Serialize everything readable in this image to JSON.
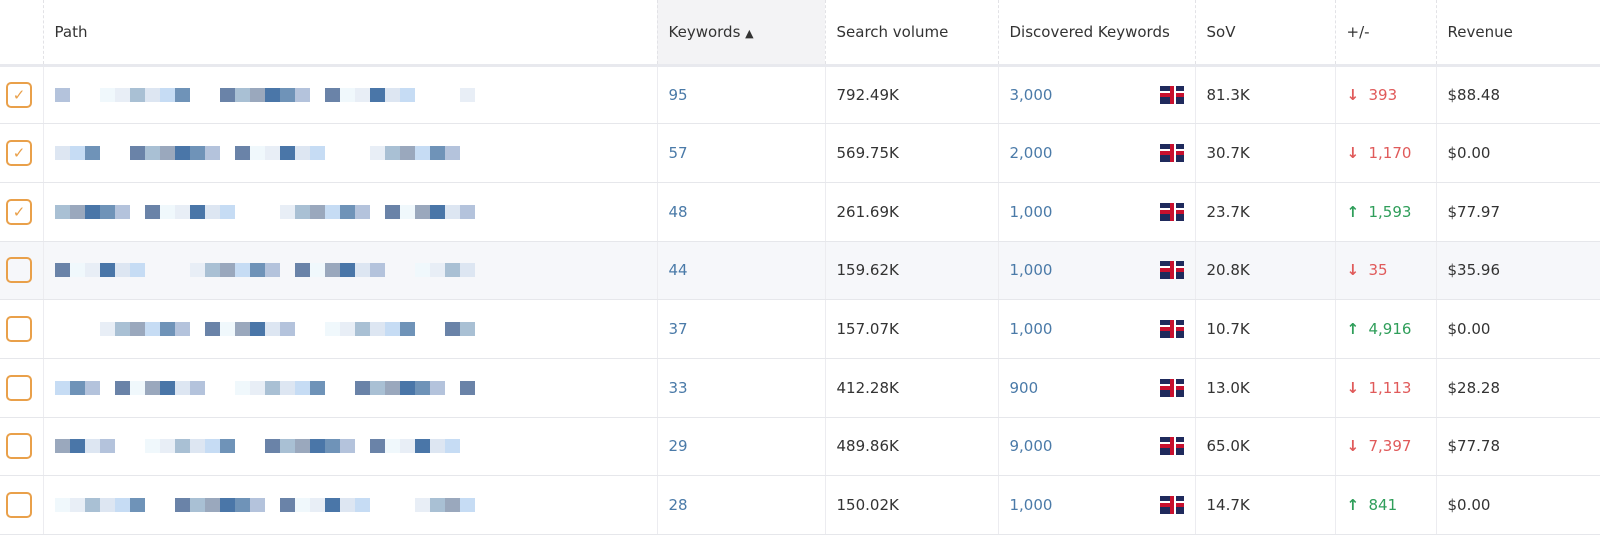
{
  "columns": {
    "path": "Path",
    "keywords": "Keywords",
    "keywords_sort": "▲",
    "search_volume": "Search volume",
    "discovered": "Discovered Keywords",
    "sov": "SoV",
    "change": "+/-",
    "revenue": "Revenue"
  },
  "colors": {
    "checkbox": "#e9a04a",
    "link": "#4a7aa8",
    "down": "#e05a5a",
    "up": "#2f9e5a"
  },
  "rows": [
    {
      "checked": true,
      "keywords": "95",
      "search_volume": "792.49K",
      "discovered": "3,000",
      "country": "uk-flag-icon",
      "sov": "81.3K",
      "dir": "down",
      "change": "393",
      "revenue": "$88.48"
    },
    {
      "checked": true,
      "keywords": "57",
      "search_volume": "569.75K",
      "discovered": "2,000",
      "country": "uk-flag-icon",
      "sov": "30.7K",
      "dir": "down",
      "change": "1,170",
      "revenue": "$0.00"
    },
    {
      "checked": true,
      "keywords": "48",
      "search_volume": "261.69K",
      "discovered": "1,000",
      "country": "uk-flag-icon",
      "sov": "23.7K",
      "dir": "up",
      "change": "1,593",
      "revenue": "$77.97"
    },
    {
      "checked": false,
      "keywords": "44",
      "search_volume": "159.62K",
      "discovered": "1,000",
      "country": "uk-flag-icon",
      "sov": "20.8K",
      "dir": "down",
      "change": "35",
      "revenue": "$35.96"
    },
    {
      "checked": false,
      "keywords": "37",
      "search_volume": "157.07K",
      "discovered": "1,000",
      "country": "uk-flag-icon",
      "sov": "10.7K",
      "dir": "up",
      "change": "4,916",
      "revenue": "$0.00"
    },
    {
      "checked": false,
      "keywords": "33",
      "search_volume": "412.28K",
      "discovered": "900",
      "country": "uk-flag-icon",
      "sov": "13.0K",
      "dir": "down",
      "change": "1,113",
      "revenue": "$28.28"
    },
    {
      "checked": false,
      "keywords": "29",
      "search_volume": "489.86K",
      "discovered": "9,000",
      "country": "uk-flag-icon",
      "sov": "65.0K",
      "dir": "down",
      "change": "7,397",
      "revenue": "$77.78"
    },
    {
      "checked": false,
      "keywords": "28",
      "search_volume": "150.02K",
      "discovered": "1,000",
      "country": "uk-flag-icon",
      "sov": "14.7K",
      "dir": "up",
      "change": "841",
      "revenue": "$0.00"
    }
  ]
}
